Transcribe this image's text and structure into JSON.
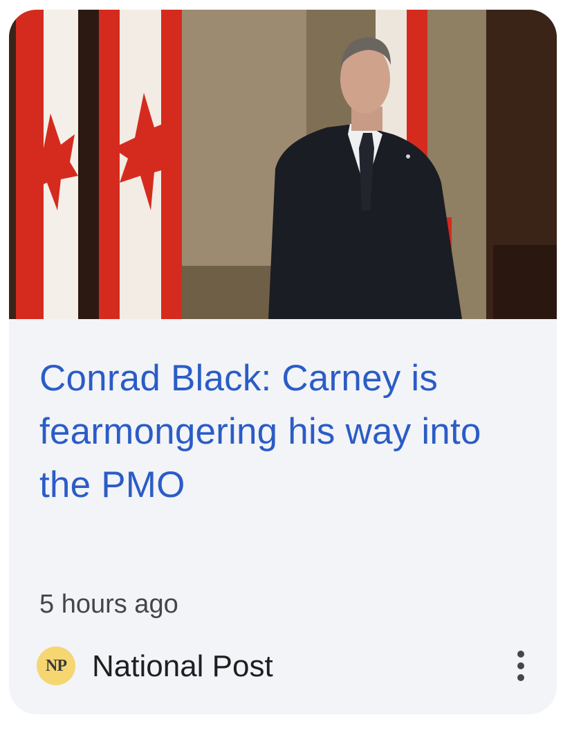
{
  "article": {
    "headline": "Conrad Black: Carney is fearmongering his way into the PMO",
    "timestamp": "5 hours ago",
    "image_icon": "news-photo"
  },
  "source": {
    "logo_text": "NP",
    "name": "National Post"
  },
  "actions": {
    "more_icon": "more-vert-icon"
  },
  "colors": {
    "headline": "#2b5cc7",
    "card_background": "#f2f4f7",
    "logo_background": "#f6d671",
    "flag_red": "#d52b1e"
  }
}
